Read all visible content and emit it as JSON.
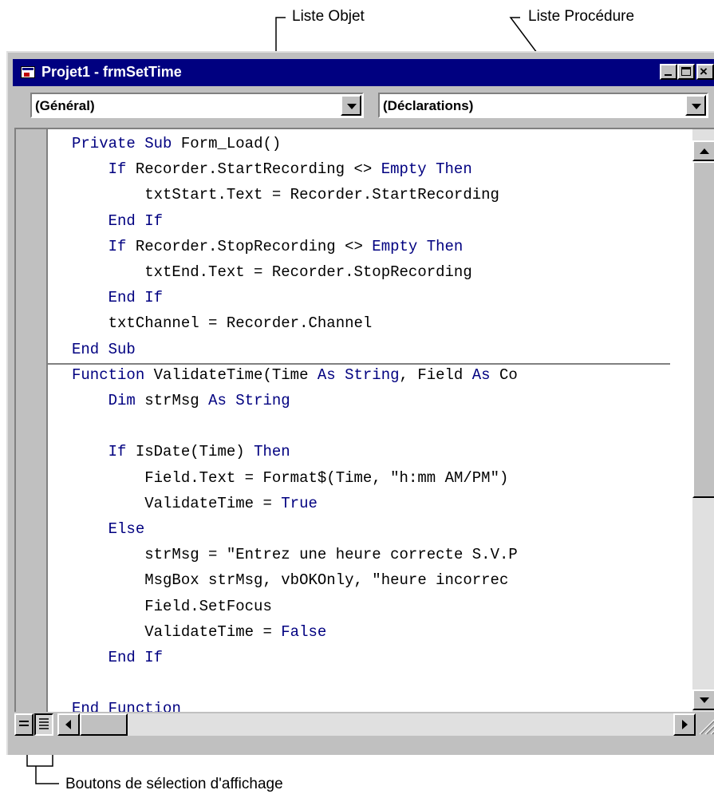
{
  "callouts": {
    "object_list": "Liste Objet",
    "procedure_list": "Liste Procédure",
    "view_buttons": "Boutons de sélection d'affichage"
  },
  "window": {
    "title": "Projet1 - frmSetTime",
    "object_combo": "(Général)",
    "procedure_combo": "(Déclarations)"
  },
  "colors": {
    "keyword": "#000080",
    "title_bar": "#000080",
    "chrome": "#c0c0c0"
  },
  "code_lines": [
    "Private Sub Form_Load()",
    "    If Recorder.StartRecording <> Empty Then",
    "        txtStart.Text = Recorder.StartRecording",
    "    End If",
    "    If Recorder.StopRecording <> Empty Then",
    "        txtEnd.Text = Recorder.StopRecording",
    "    End If",
    "    txtChannel = Recorder.Channel",
    "End Sub",
    "Function ValidateTime(Time As String, Field As Co",
    "    Dim strMsg As String",
    "",
    "    If IsDate(Time) Then",
    "        Field.Text = Format$(Time, \"h:mm AM/PM\")",
    "        ValidateTime = True",
    "    Else",
    "        strMsg = \"Entrez une heure correcte S.V.P",
    "        MsgBox strMsg, vbOKOnly, \"heure incorrec",
    "        Field.SetFocus",
    "        ValidateTime = False",
    "    End If",
    "",
    "End Function"
  ],
  "keywords": [
    "Private",
    "Sub",
    "If",
    "Then",
    "Empty",
    "End",
    "Function",
    "As",
    "String",
    "Dim",
    "True",
    "False",
    "Else"
  ]
}
